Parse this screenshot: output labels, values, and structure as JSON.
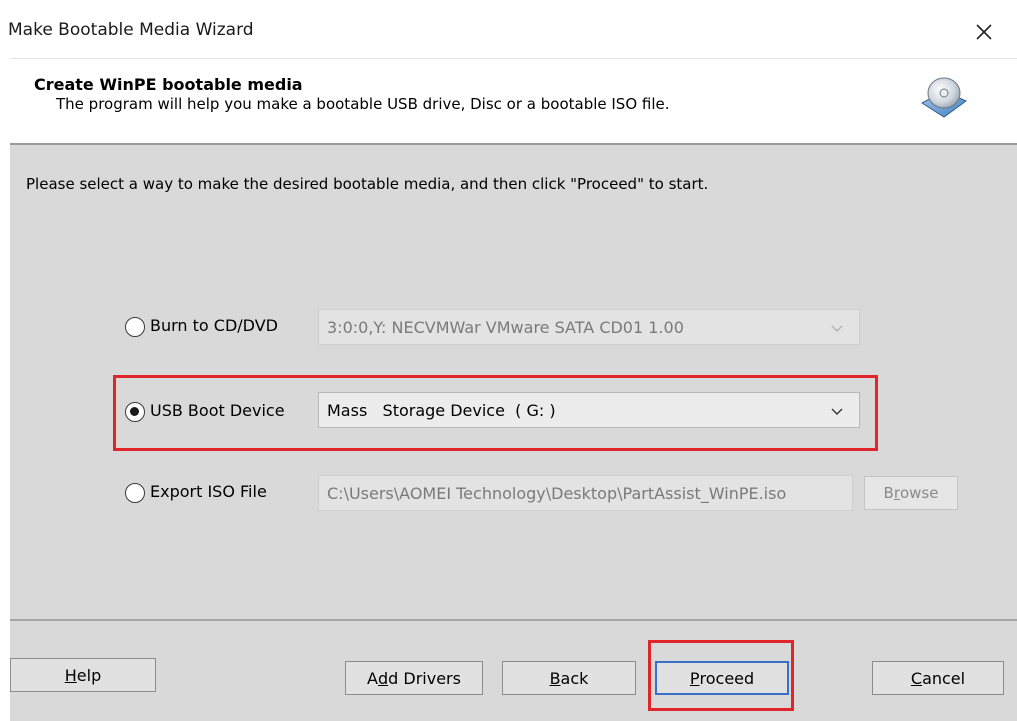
{
  "window": {
    "title": "Make Bootable Media Wizard",
    "close_glyph": "✕"
  },
  "header": {
    "title": "Create WinPE bootable media",
    "subtitle": "The program will help you make a bootable USB drive, Disc or a bootable ISO file.",
    "icon": "disc-icon"
  },
  "instruction": "Please select a way to make the desired bootable media, and then click \"Proceed\" to start.",
  "options": {
    "cd": {
      "label": "Burn to CD/DVD",
      "value": "3:0:0,Y: NECVMWar VMware SATA CD01 1.00",
      "selected": false,
      "enabled": false
    },
    "usb": {
      "label": "USB Boot Device",
      "value": "Mass   Storage Device  ( G: )",
      "selected": true,
      "enabled": true
    },
    "iso": {
      "label": "Export ISO File",
      "value": "C:\\Users\\AOMEI Technology\\Desktop\\PartAssist_WinPE.iso",
      "browse_label_pre": "B",
      "browse_label_key": "r",
      "browse_label_post": "owse",
      "selected": false,
      "enabled": false
    }
  },
  "buttons": {
    "help": {
      "key": "H",
      "rest": "elp"
    },
    "add_drivers": {
      "pre": "A",
      "key": "d",
      "rest": "d Drivers"
    },
    "back": {
      "key": "B",
      "rest": "ack"
    },
    "proceed": {
      "key": "P",
      "rest": "roceed"
    },
    "cancel": {
      "key": "C",
      "rest": "ancel"
    }
  },
  "colors": {
    "highlight": "#e0262a",
    "content_bg": "#d9d9d9",
    "default_button_border": "#3c6fc8"
  }
}
